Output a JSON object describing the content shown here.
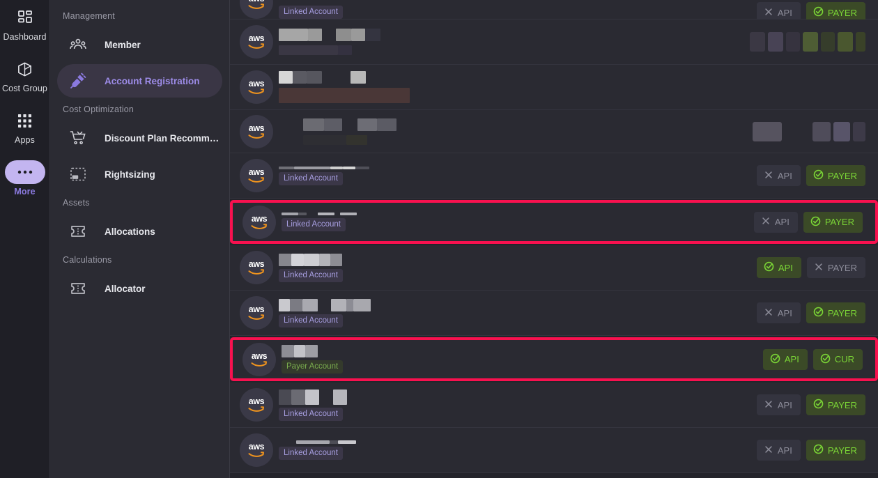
{
  "rail": {
    "items": [
      {
        "label": "Dashboard",
        "icon": "dashboard-icon",
        "active": false
      },
      {
        "label": "Cost Group",
        "icon": "cube-icon",
        "active": false
      },
      {
        "label": "Apps",
        "icon": "grid-icon",
        "active": false
      },
      {
        "label": "More",
        "icon": "ellipsis-icon",
        "active": true
      }
    ]
  },
  "sidebar": {
    "sections": [
      {
        "title": "Management",
        "items": [
          {
            "label": "Member",
            "icon": "people-icon",
            "active": false
          },
          {
            "label": "Account Registration",
            "icon": "plug-icon",
            "active": true
          }
        ]
      },
      {
        "title": "Cost Optimization",
        "items": [
          {
            "label": "Discount Plan Recommend…",
            "icon": "cart-icon",
            "active": false
          },
          {
            "label": "Rightsizing",
            "icon": "resize-icon",
            "active": false
          }
        ]
      },
      {
        "title": "Assets",
        "items": [
          {
            "label": "Allocations",
            "icon": "ticket-icon",
            "active": false
          }
        ]
      },
      {
        "title": "Calculations",
        "items": [
          {
            "label": "Allocator",
            "icon": "ticket-icon",
            "active": false
          }
        ]
      }
    ]
  },
  "colors": {
    "accent_purple": "#9d8ce8",
    "highlight_pink": "#f8114f",
    "status_on_text": "#7bd636",
    "status_on_bg": "#3b4a27",
    "status_off_text": "#8c8c99",
    "status_off_bg": "#34343f",
    "aws_orange": "#f0941e",
    "row_bg": "#2a2a32",
    "page_bg": "#24242b"
  },
  "list": {
    "provider_logo_text": "aws",
    "account_type_labels": {
      "linked": "Linked Account",
      "payer": "Payer Account"
    },
    "status_labels": {
      "api": "API",
      "payer": "PAYER",
      "cur": "CUR"
    },
    "rows": [
      {
        "id": "row-1",
        "height": 28,
        "clipped_top": true,
        "account_type": "Linked Account",
        "name_blocks": [],
        "statuses": [
          {
            "label": "API",
            "state": "off"
          },
          {
            "label": "PAYER",
            "state": "on"
          }
        ],
        "status_redacted": true,
        "highlight": false
      },
      {
        "id": "row-2",
        "height": 65,
        "account_type": null,
        "name_blocks": [
          {
            "w": 42,
            "c": "#a6a6a6"
          },
          {
            "w": 20,
            "c": "#9a9a9a"
          },
          {
            "w": 20,
            "c": "transparent"
          },
          {
            "w": 22,
            "c": "#8e8e8e"
          },
          {
            "w": 20,
            "c": "#9a9a9a"
          },
          {
            "w": 22,
            "c": "#343440"
          }
        ],
        "sub_blocks": [
          {
            "w": 85,
            "c": "#3a3744"
          },
          {
            "w": 20,
            "c": "#343140"
          }
        ],
        "statuses": [],
        "status_blocks": [
          {
            "w": 22,
            "c": "#3b3844"
          },
          {
            "w": 22,
            "c": "#484355"
          },
          {
            "w": 20,
            "c": "#36333f"
          },
          {
            "w": 22,
            "c": "#4e5d34"
          },
          {
            "w": 20,
            "c": "#363d2b"
          },
          {
            "w": 22,
            "c": "#4a572f"
          },
          {
            "w": 14,
            "c": "#3a4228"
          }
        ],
        "highlight": false
      },
      {
        "id": "row-3",
        "height": 65,
        "account_type": null,
        "name_blocks": [
          {
            "w": 20,
            "c": "#d6d6d6"
          },
          {
            "w": 20,
            "c": "#5a5a62"
          },
          {
            "w": 22,
            "c": "#56565e"
          },
          {
            "w": 41,
            "c": "transparent"
          },
          {
            "w": 22,
            "c": "#b8b8b8"
          }
        ],
        "sub_blocks": [
          {
            "w": 188,
            "c": "#4a3737"
          }
        ],
        "sub_h": 22,
        "statuses": [],
        "status_blocks": [],
        "highlight": false
      },
      {
        "id": "row-4",
        "height": 62,
        "account_type": null,
        "indent": 35,
        "name_blocks": [
          {
            "w": 30,
            "c": "#6b6b72"
          },
          {
            "w": 26,
            "c": "#5d5d66"
          },
          {
            "w": 22,
            "c": "transparent"
          },
          {
            "w": 28,
            "c": "#6d6d75"
          },
          {
            "w": 28,
            "c": "#5b5b64"
          }
        ],
        "sub_blocks": [
          {
            "w": 62,
            "c": "#2e2e33"
          },
          {
            "w": 30,
            "c": "#33332e"
          }
        ],
        "statuses": [],
        "status_blocks": [
          {
            "w": 42,
            "c": "#56535f"
          },
          {
            "w": 36,
            "c": "transparent"
          },
          {
            "w": 26,
            "c": "#4f4c5a"
          },
          {
            "w": 24,
            "c": "#585469"
          },
          {
            "w": 18,
            "c": "#3d3a48"
          }
        ],
        "highlight": false
      },
      {
        "id": "row-5",
        "height": 65,
        "account_type": "Linked Account",
        "name_blocks": [
          {
            "w": 22,
            "c": "#6f6f76"
          },
          {
            "w": 52,
            "c": "#9c9ca3"
          },
          {
            "w": 18,
            "c": "#cfcfcf"
          },
          {
            "w": 18,
            "c": "#d6d6d6"
          },
          {
            "w": 20,
            "c": "#4f4f58"
          }
        ],
        "name_h": 4,
        "statuses": [
          {
            "label": "API",
            "state": "off"
          },
          {
            "label": "PAYER",
            "state": "on"
          }
        ],
        "highlight": false
      },
      {
        "id": "row-6",
        "height": 63,
        "account_type": "Linked Account",
        "name_blocks": [
          {
            "w": 24,
            "c": "#a5a5ac"
          },
          {
            "w": 12,
            "c": "#57575f"
          },
          {
            "w": 16,
            "c": "transparent"
          },
          {
            "w": 24,
            "c": "#b5b5bb"
          },
          {
            "w": 8,
            "c": "transparent"
          },
          {
            "w": 24,
            "c": "#b0b0b6"
          }
        ],
        "name_h": 4,
        "statuses": [
          {
            "label": "API",
            "state": "off"
          },
          {
            "label": "PAYER",
            "state": "on"
          }
        ],
        "highlight": true
      },
      {
        "id": "row-7",
        "height": 65,
        "account_type": "Linked Account",
        "name_blocks": [
          {
            "w": 18,
            "c": "#87878e"
          },
          {
            "w": 18,
            "c": "#d3d3d8"
          },
          {
            "w": 22,
            "c": "#cdcdd2"
          },
          {
            "w": 16,
            "c": "#b3b3b9"
          },
          {
            "w": 17,
            "c": "#8d8d94"
          }
        ],
        "name_h": 18,
        "statuses": [
          {
            "label": "API",
            "state": "on"
          },
          {
            "label": "PAYER",
            "state": "off"
          }
        ],
        "highlight": false
      },
      {
        "id": "row-8",
        "height": 65,
        "account_type": "Linked Account",
        "name_blocks": [
          {
            "w": 16,
            "c": "#c9c9ce"
          },
          {
            "w": 18,
            "c": "#7b7b83"
          },
          {
            "w": 22,
            "c": "#a9a9b0"
          },
          {
            "w": 19,
            "c": "transparent"
          },
          {
            "w": 22,
            "c": "#b2b2b8"
          },
          {
            "w": 10,
            "c": "#8c8c94"
          },
          {
            "w": 25,
            "c": "#a8a8ae"
          }
        ],
        "name_h": 18,
        "statuses": [
          {
            "label": "API",
            "state": "off"
          },
          {
            "label": "PAYER",
            "state": "on"
          }
        ],
        "highlight": false
      },
      {
        "id": "row-9",
        "height": 63,
        "account_type": "Payer Account",
        "name_blocks": [
          {
            "w": 18,
            "c": "#8d8d95"
          },
          {
            "w": 16,
            "c": "#c2c2c8"
          },
          {
            "w": 18,
            "c": "#9d9da4"
          }
        ],
        "name_h": 18,
        "statuses": [
          {
            "label": "API",
            "state": "on"
          },
          {
            "label": "CUR",
            "state": "on"
          }
        ],
        "highlight": true
      },
      {
        "id": "row-10",
        "height": 65,
        "account_type": "Linked Account",
        "name_blocks": [
          {
            "w": 18,
            "c": "#4a4a53"
          },
          {
            "w": 20,
            "c": "#6b6b73"
          },
          {
            "w": 20,
            "c": "#c3c3c9"
          },
          {
            "w": 20,
            "c": "transparent"
          },
          {
            "w": 20,
            "c": "#b6b6bc"
          }
        ],
        "name_h": 22,
        "statuses": [
          {
            "label": "API",
            "state": "off"
          },
          {
            "label": "PAYER",
            "state": "on"
          }
        ],
        "highlight": false
      },
      {
        "id": "row-11",
        "height": 65,
        "account_type": "Linked Account",
        "name_blocks": [
          {
            "w": 25,
            "c": "transparent"
          },
          {
            "w": 48,
            "c": "#a7a7ae"
          },
          {
            "w": 12,
            "c": "#4d4d56"
          },
          {
            "w": 26,
            "c": "#c8c8cd"
          }
        ],
        "name_h": 5,
        "statuses": [
          {
            "label": "API",
            "state": "off"
          },
          {
            "label": "PAYER",
            "state": "on"
          }
        ],
        "highlight": false
      }
    ]
  }
}
